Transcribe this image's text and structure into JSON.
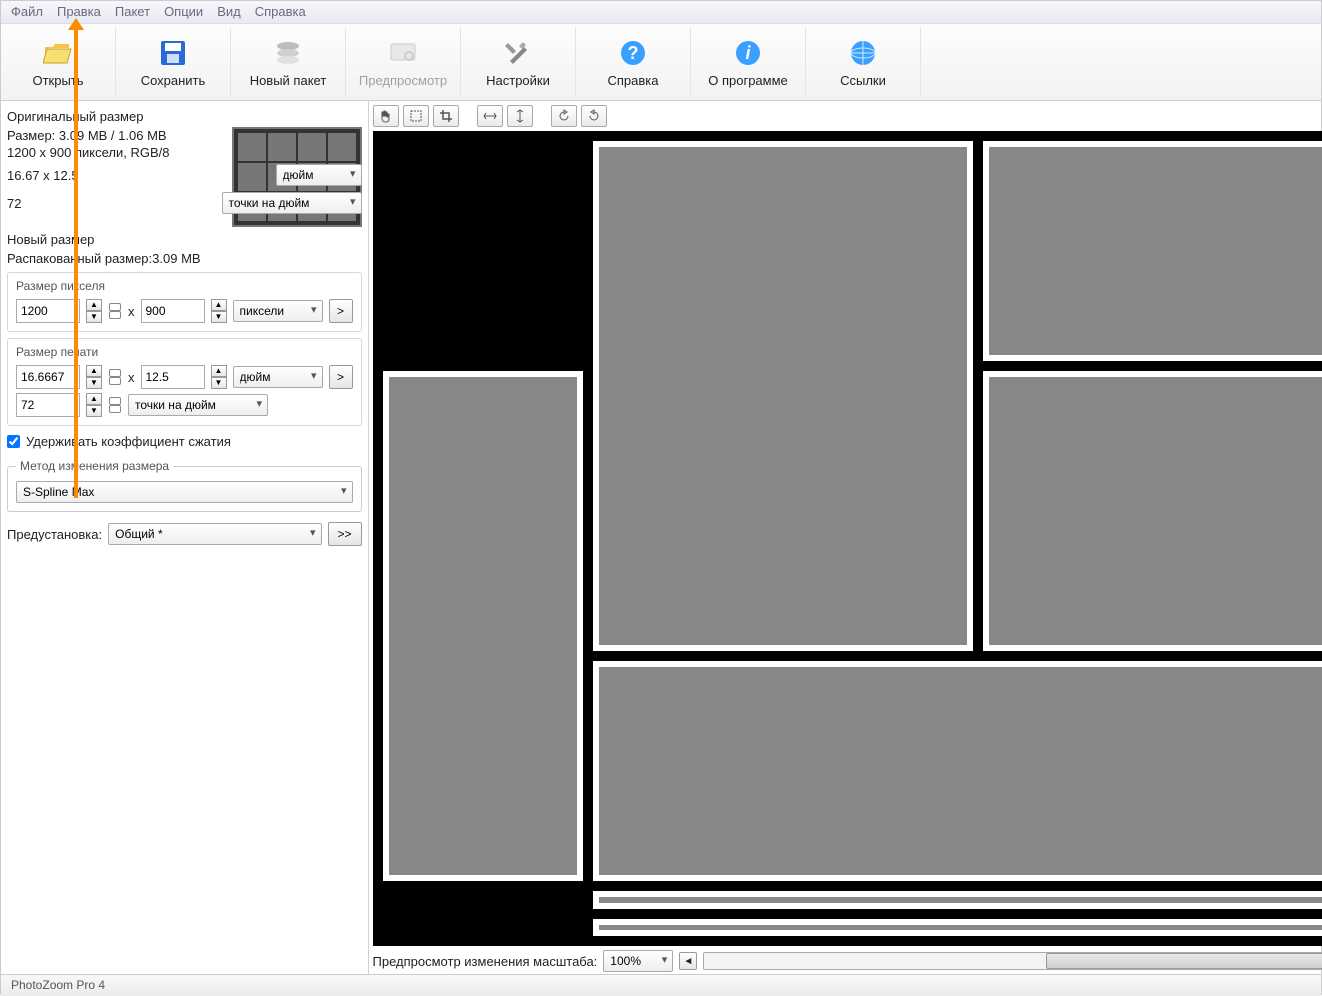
{
  "menu": {
    "file": "Файл",
    "edit": "Правка",
    "batch": "Пакет",
    "options": "Опции",
    "view": "Вид",
    "help": "Справка"
  },
  "toolbar": {
    "open": "Открыть",
    "save": "Сохранить",
    "newbatch": "Новый пакет",
    "preview": "Предпросмотр",
    "settings": "Настройки",
    "helpbtn": "Справка",
    "about": "О программе",
    "links": "Ссылки"
  },
  "orig": {
    "title": "Оригинальный размер",
    "size": "Размер: 3.09 MB / 1.06 MB",
    "pixels": "1200 x 900 пиксели, RGB/8",
    "dims": "16.67 x 12.5",
    "unit_inch": "дюйм",
    "res": "72",
    "unit_dpi": "точки на дюйм"
  },
  "newsize": {
    "title": "Новый размер",
    "unpacked": "Распакованный размер:3.09 MB",
    "pixel_size_label": "Размер пикселя",
    "w": "1200",
    "h": "900",
    "unit_px": "пиксели",
    "print_size_label": "Размер печати",
    "pw": "16.6667",
    "ph": "12.5",
    "unit_inch": "дюйм",
    "res": "72",
    "unit_dpi": "точки на дюйм",
    "keep_ratio": "Удерживать коэффициент сжатия"
  },
  "method": {
    "legend": "Метод изменения размера",
    "value": "S-Spline Max",
    "preset_label": "Предустановка:",
    "preset_value": "Общий *",
    "more": ">>"
  },
  "previewbar": {
    "label": "Предпросмотр изменения масштаба:",
    "zoom": "100%"
  },
  "status": "PhotoZoom Pro 4"
}
